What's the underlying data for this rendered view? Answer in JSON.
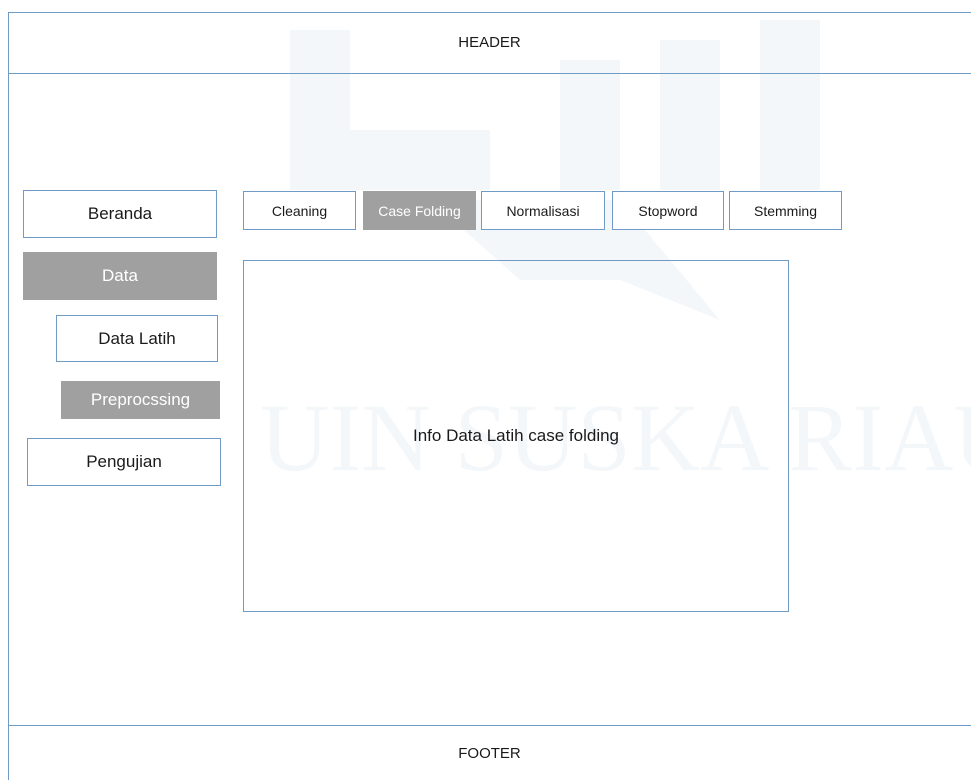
{
  "header": {
    "label": "HEADER"
  },
  "footer": {
    "label": "FOOTER"
  },
  "sidebar": {
    "items": [
      {
        "label": "Beranda",
        "active": false
      },
      {
        "label": "Data",
        "active": true
      },
      {
        "label": "Data Latih",
        "active": false
      },
      {
        "label": "Preprocssing",
        "active": true
      },
      {
        "label": "Pengujian",
        "active": false
      }
    ]
  },
  "tabs": [
    {
      "label": "Cleaning",
      "active": false
    },
    {
      "label": "Case Folding",
      "active": true
    },
    {
      "label": "Normalisasi",
      "active": false
    },
    {
      "label": "Stopword",
      "active": false
    },
    {
      "label": "Stemming",
      "active": false
    }
  ],
  "main": {
    "info_text": "Info Data Latih case folding"
  },
  "colors": {
    "border": "#6f9bc6",
    "active_fill": "#a0a0a0",
    "active_text": "#ffffff"
  }
}
